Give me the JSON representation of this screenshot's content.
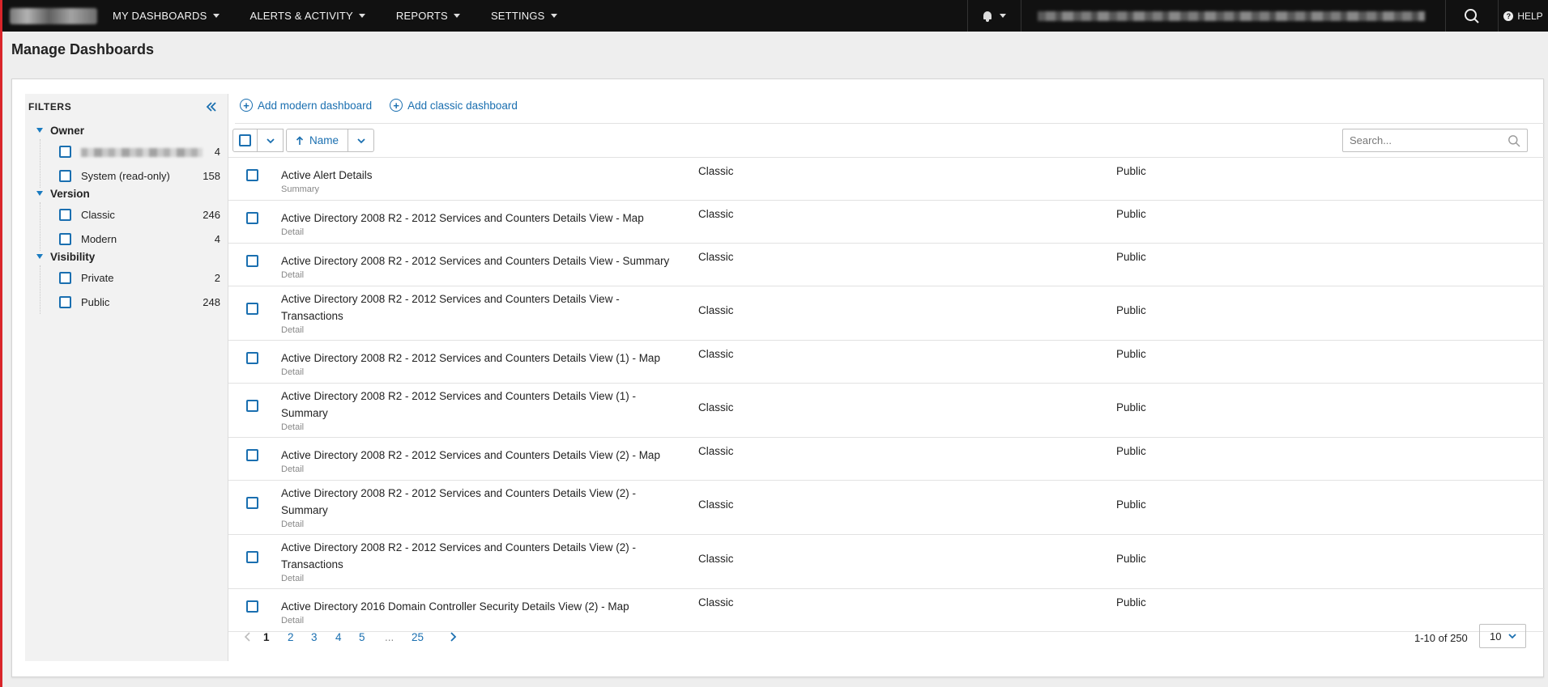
{
  "nav": {
    "items": [
      {
        "label": "MY DASHBOARDS"
      },
      {
        "label": "ALERTS & ACTIVITY"
      },
      {
        "label": "REPORTS"
      },
      {
        "label": "SETTINGS"
      }
    ],
    "help_label": "HELP"
  },
  "page_title": "Manage Dashboards",
  "filters": {
    "title": "FILTERS",
    "groups": [
      {
        "label": "Owner",
        "items": [
          {
            "label": "",
            "count": "4"
          },
          {
            "label": "System (read-only)",
            "count": "158"
          }
        ]
      },
      {
        "label": "Version",
        "items": [
          {
            "label": "Classic",
            "count": "246"
          },
          {
            "label": "Modern",
            "count": "4"
          }
        ]
      },
      {
        "label": "Visibility",
        "items": [
          {
            "label": "Private",
            "count": "2"
          },
          {
            "label": "Public",
            "count": "248"
          }
        ]
      }
    ]
  },
  "actions": {
    "add_modern": "Add modern dashboard",
    "add_classic": "Add classic dashboard"
  },
  "sort": {
    "label": "Name"
  },
  "search": {
    "placeholder": "Search..."
  },
  "rows": [
    {
      "name": "Active Alert Details",
      "type": "Summary",
      "version": "Classic",
      "visibility": "Public"
    },
    {
      "name": "Active Directory 2008 R2 - 2012 Services and Counters Details View - Map",
      "type": "Detail",
      "version": "Classic",
      "visibility": "Public"
    },
    {
      "name": "Active Directory 2008 R2 - 2012 Services and Counters Details View - Summary",
      "type": "Detail",
      "version": "Classic",
      "visibility": "Public"
    },
    {
      "name": "Active Directory 2008 R2 - 2012 Services and Counters Details View - Transactions",
      "type": "Detail",
      "version": "Classic",
      "visibility": "Public"
    },
    {
      "name": "Active Directory 2008 R2 - 2012 Services and Counters Details View (1) - Map",
      "type": "Detail",
      "version": "Classic",
      "visibility": "Public"
    },
    {
      "name": "Active Directory 2008 R2 - 2012 Services and Counters Details View (1) - Summary",
      "type": "Detail",
      "version": "Classic",
      "visibility": "Public"
    },
    {
      "name": "Active Directory 2008 R2 - 2012 Services and Counters Details View (2) - Map",
      "type": "Detail",
      "version": "Classic",
      "visibility": "Public"
    },
    {
      "name": "Active Directory 2008 R2 - 2012 Services and Counters Details View (2) - Summary",
      "type": "Detail",
      "version": "Classic",
      "visibility": "Public"
    },
    {
      "name": "Active Directory 2008 R2 - 2012 Services and Counters Details View (2) - Transactions",
      "type": "Detail",
      "version": "Classic",
      "visibility": "Public"
    },
    {
      "name": "Active Directory 2016 Domain Controller Security Details View (2) - Map",
      "type": "Detail",
      "version": "Classic",
      "visibility": "Public"
    }
  ],
  "pagination": {
    "pages": [
      "1",
      "2",
      "3",
      "4",
      "5",
      "...",
      "25"
    ],
    "current": "1",
    "range": "1-10 of 250",
    "page_size": "10"
  },
  "colors": {
    "accent": "#1a6fb0",
    "topbar": "#111111",
    "page_bg": "#eeeeee"
  },
  "icons": {
    "bell": "bell-icon",
    "search": "search-icon",
    "help": "help-icon",
    "collapse": "double-chevron-left-icon",
    "add": "plus-circle-icon",
    "sort": "arrow-up-icon"
  }
}
